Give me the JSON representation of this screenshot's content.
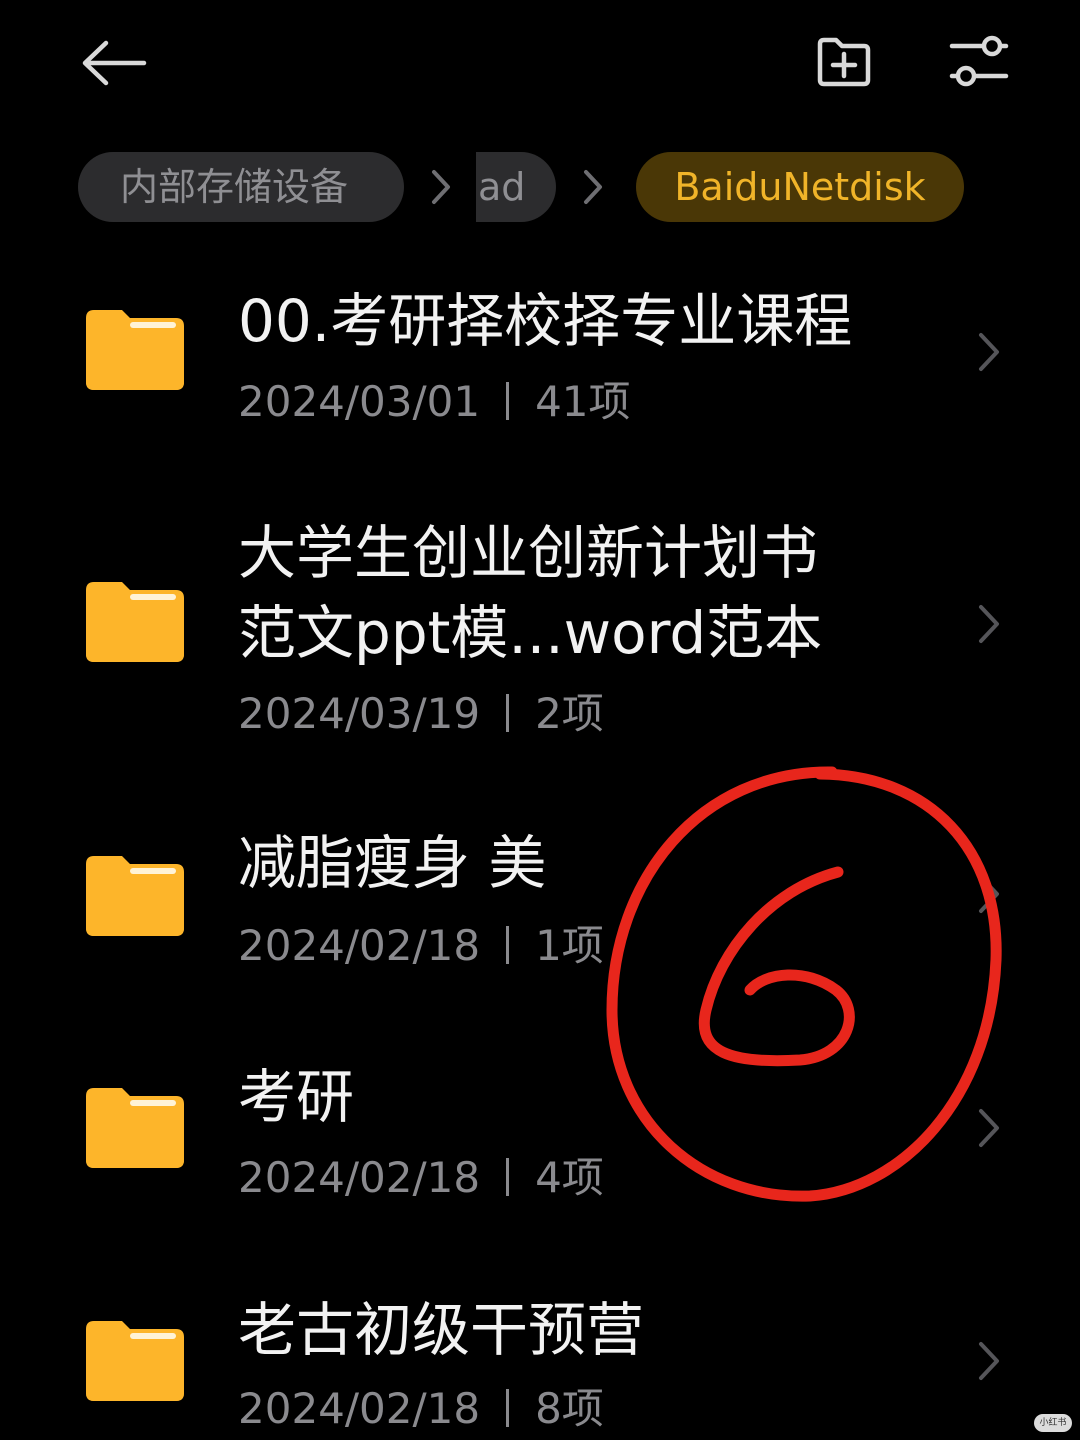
{
  "header": {
    "back_icon": "back-arrow-icon",
    "new_folder_icon": "new-folder-icon",
    "filter_icon": "sliders-icon"
  },
  "breadcrumb": {
    "items": [
      "内部存储设备",
      "ad",
      "BaiduNetdisk"
    ],
    "accent_bg": "#4a3706",
    "accent_text": "#f0b429"
  },
  "folders": [
    {
      "name": "00.考研择校择专业课程",
      "date": "2024/03/01",
      "count": "41项"
    },
    {
      "name_line1": "大学生创业创新计划书",
      "name_line2": "范文ppt模...word范本",
      "date": "2024/03/19",
      "count": "2项"
    },
    {
      "name": "减脂瘦身 美",
      "date": "2024/02/18",
      "count": "1项"
    },
    {
      "name": "考研",
      "date": "2024/02/18",
      "count": "4项"
    },
    {
      "name": "老古初级干预营",
      "date": "2024/02/18",
      "count": "8项"
    }
  ],
  "annotation": {
    "text": "6",
    "color": "#e8261c"
  },
  "watermark": "小红书",
  "colors": {
    "folder": "#fdb52a",
    "background": "#000000"
  }
}
